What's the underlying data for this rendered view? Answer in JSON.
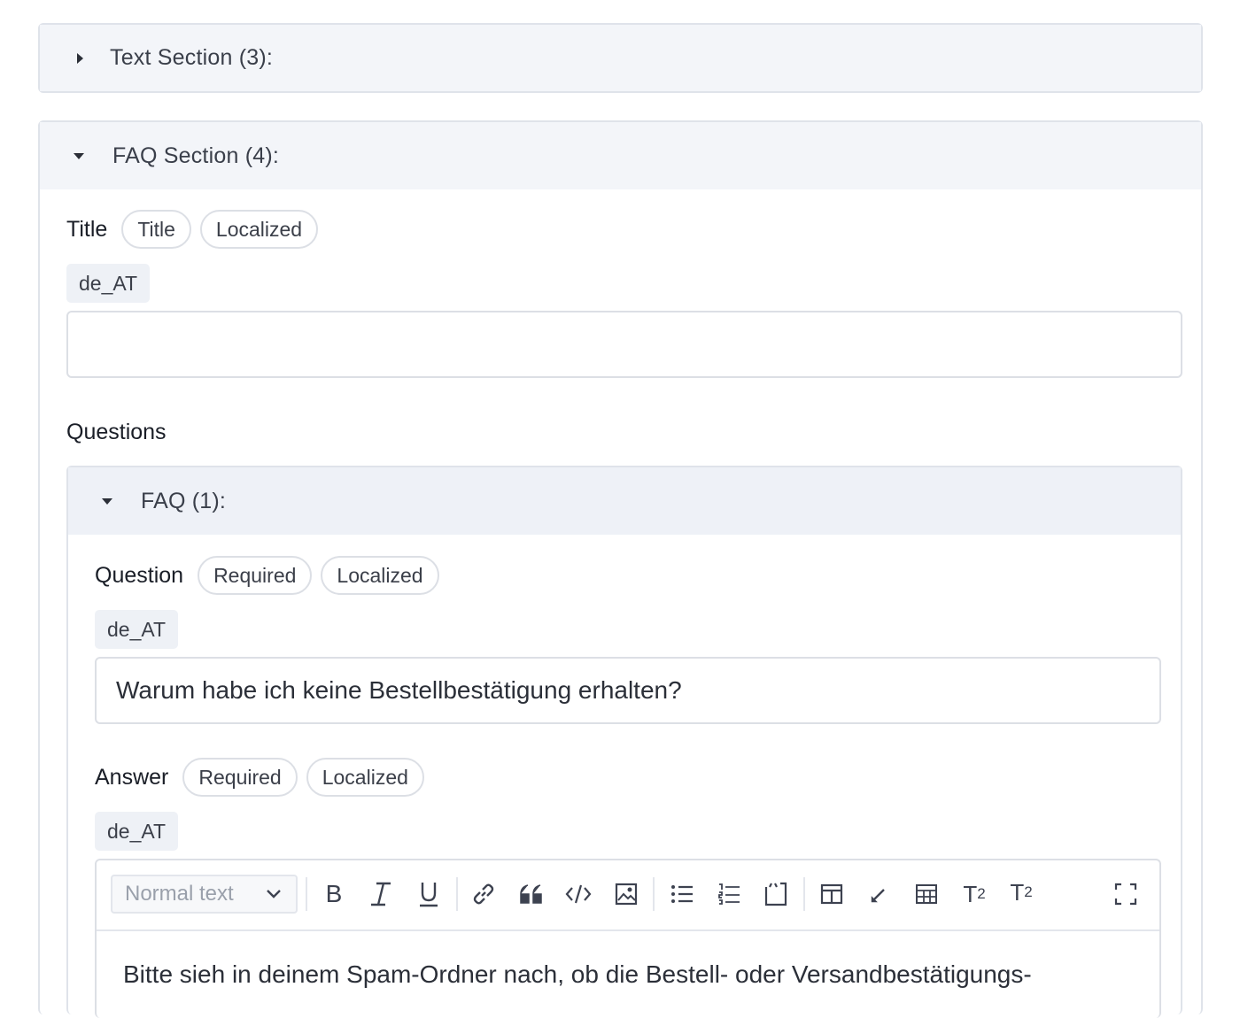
{
  "text_section": {
    "label": "Text Section (3):",
    "expanded": false
  },
  "faq_section": {
    "label": "FAQ Section (4):",
    "expanded": true,
    "title_field": {
      "label": "Title",
      "chips": [
        "Title",
        "Localized"
      ],
      "locale": "de_AT",
      "value": ""
    },
    "questions_label": "Questions",
    "faq_item": {
      "label": "FAQ (1):",
      "expanded": true,
      "question": {
        "label": "Question",
        "chips": [
          "Required",
          "Localized"
        ],
        "locale": "de_AT",
        "value": "Warum habe ich keine Bestellbestätigung erhalten?"
      },
      "answer": {
        "label": "Answer",
        "chips": [
          "Required",
          "Localized"
        ],
        "locale": "de_AT",
        "editor": {
          "format_select": "Normal text",
          "toolbar_icons": [
            "bold-icon",
            "italic-icon",
            "underline-icon",
            "link-icon",
            "quote-icon",
            "code-icon",
            "image-icon",
            "bullet-list-icon",
            "numbered-list-icon",
            "code-block-icon",
            "layout-icon",
            "highlight-icon",
            "table-icon",
            "subscript-icon",
            "superscript-icon",
            "fullscreen-icon"
          ],
          "content": "Bitte sieh in deinem Spam-Ordner nach, ob die Bestell- oder Versandbestätigungs-"
        }
      }
    }
  }
}
